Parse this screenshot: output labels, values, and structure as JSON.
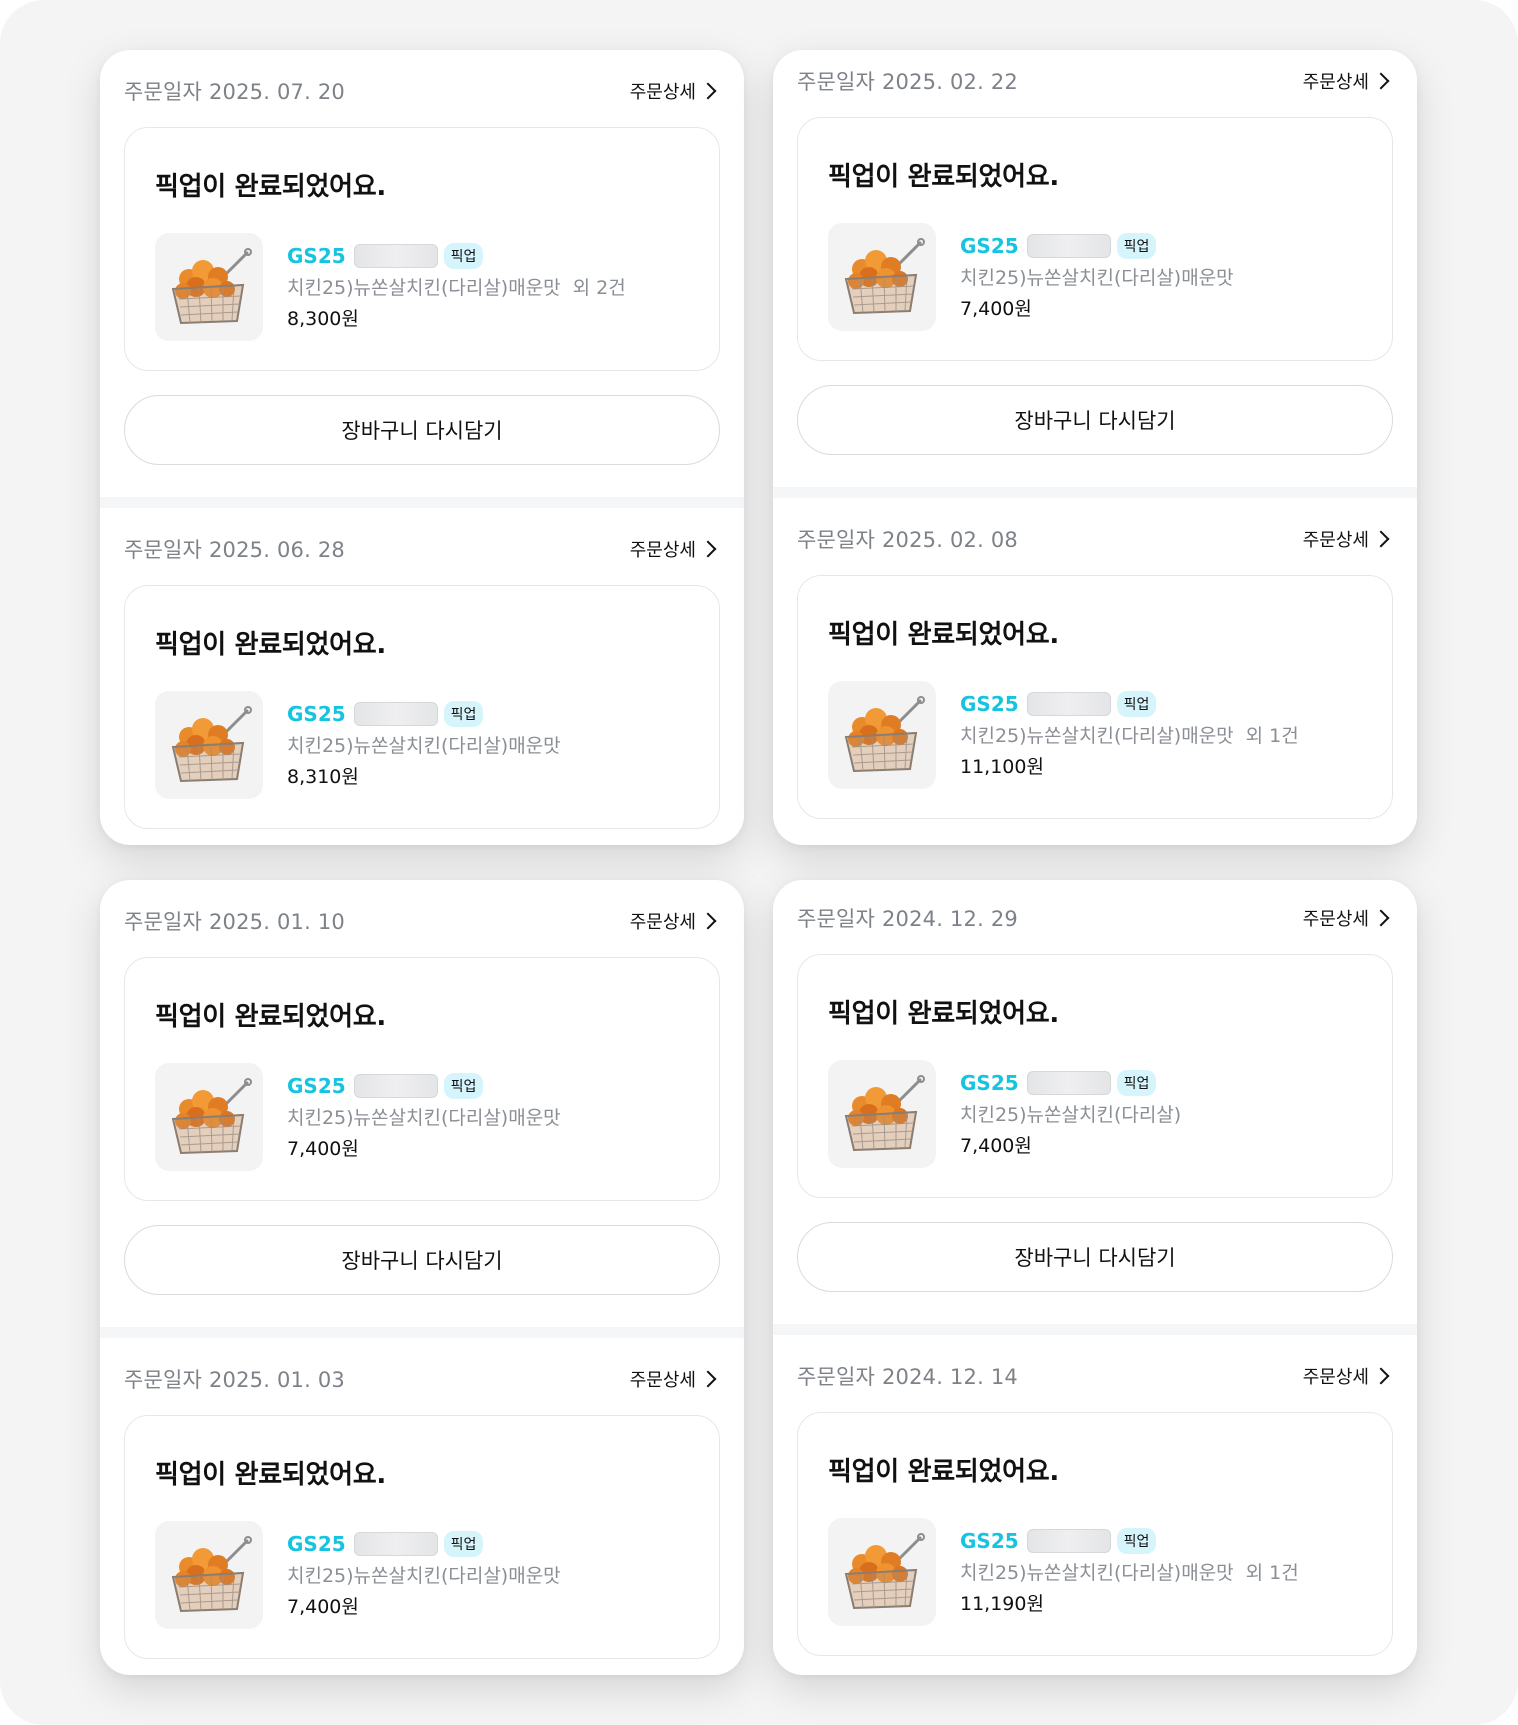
{
  "common": {
    "date_prefix": "주문일자",
    "detail_label": "주문상세",
    "status_title": "픽업이 완료되었어요.",
    "store_name": "GS25",
    "pickup_badge": "픽업",
    "reorder_label": "장바구니 다시담기"
  },
  "colors": {
    "store_accent": "#17c4e0",
    "badge_bg": "#d6f4fb",
    "date_gray": "#7d8289"
  },
  "orders": [
    {
      "date": "2025. 07. 20",
      "product": "치킨25)뉴쏜살치킨(다리살)매운맛",
      "extra": "외 2건",
      "price": "8,300원",
      "has_reorder": true
    },
    {
      "date": "2025. 06. 28",
      "product": "치킨25)뉴쏜살치킨(다리살)매운맛",
      "extra": "",
      "price": "8,310원",
      "has_reorder": false
    },
    {
      "date": "2025. 02. 22",
      "product": "치킨25)뉴쏜살치킨(다리살)매운맛",
      "extra": "",
      "price": "7,400원",
      "has_reorder": true
    },
    {
      "date": "2025. 02. 08",
      "product": "치킨25)뉴쏜살치킨(다리살)매운맛",
      "extra": "외 1건",
      "price": "11,100원",
      "has_reorder": false
    },
    {
      "date": "2025. 01. 10",
      "product": "치킨25)뉴쏜살치킨(다리살)매운맛",
      "extra": "",
      "price": "7,400원",
      "has_reorder": true
    },
    {
      "date": "2025. 01. 03",
      "product": "치킨25)뉴쏜살치킨(다리살)매운맛",
      "extra": "",
      "price": "7,400원",
      "has_reorder": false
    },
    {
      "date": "2024. 12. 29",
      "product": "치킨25)뉴쏜살치킨(다리살)",
      "extra": "",
      "price": "7,400원",
      "has_reorder": true
    },
    {
      "date": "2024. 12. 14",
      "product": "치킨25)뉴쏜살치킨(다리살)매운맛",
      "extra": "외 1건",
      "price": "11,190원",
      "has_reorder": false
    }
  ]
}
